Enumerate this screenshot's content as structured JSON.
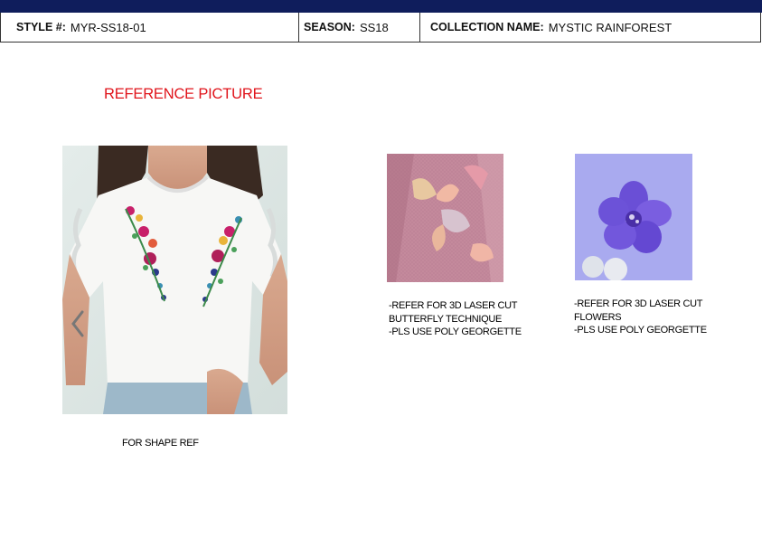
{
  "header": {
    "style_label": "STYLE #:",
    "style_value": "MYR-SS18-01",
    "season_label": "SEASON:",
    "season_value": "SS18",
    "collection_label": "COLLECTION NAME:",
    "collection_value": "MYSTIC RAINFOREST"
  },
  "reference_title": "REFERENCE PICTURE",
  "references": [
    {
      "image": "embroidered-tshirt-photo",
      "icon": "chevron-left-icon",
      "caption_lines": [
        "FOR SHAPE REF"
      ]
    },
    {
      "image": "laser-cut-butterfly-photo",
      "caption_lines": [
        "-REFER FOR 3D LASER CUT",
        "BUTTERFLY TECHNIQUE",
        "-PLS USE POLY GEORGETTE"
      ]
    },
    {
      "image": "laser-cut-flower-photo",
      "caption_lines": [
        "-REFER FOR 3D LASER CUT",
        "FLOWERS",
        "-PLS USE POLY GEORGETTE"
      ]
    }
  ],
  "colors": {
    "top_band": "#0f1d5c",
    "title_red": "#e0141b",
    "border": "#333333"
  }
}
